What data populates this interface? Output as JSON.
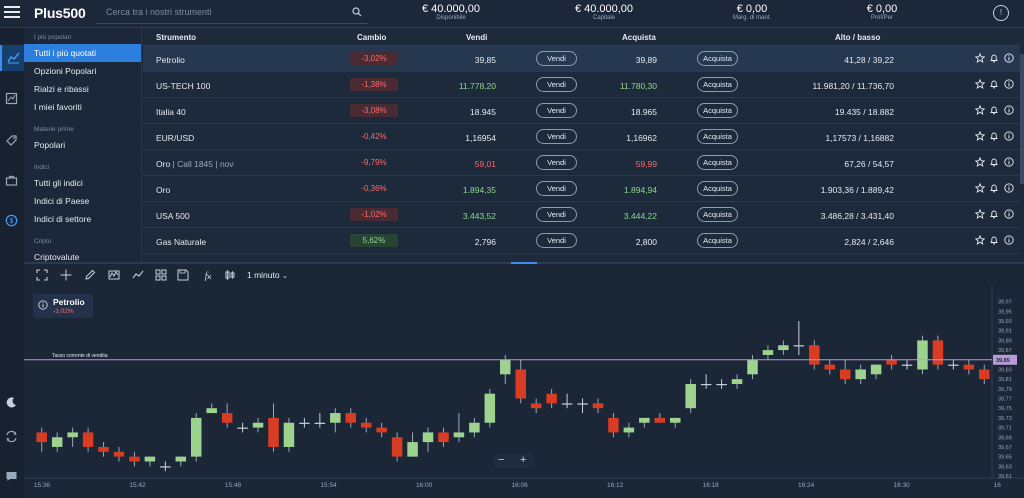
{
  "topbar": {
    "brand": "Plus500",
    "search_placeholder": "Cerca tra i nostri strumenti",
    "stats": [
      {
        "value": "€ 40.000,00",
        "label": "Disponibile"
      },
      {
        "value": "€ 40.000,00",
        "label": "Capitale"
      },
      {
        "value": "€ 0,00",
        "label": "Marg. di mant."
      },
      {
        "value": "€ 0,00",
        "label": "Prof/Per"
      }
    ]
  },
  "sidebar": {
    "sections": [
      {
        "title": "I più popolari",
        "items": [
          "Tutti i più quotati",
          "Opzioni Popolari",
          "Rialzi e ribassi",
          "I miei favoriti"
        ]
      },
      {
        "title": "Materie prime",
        "items": [
          "Popolari"
        ]
      },
      {
        "title": "Indici",
        "items": [
          "Tutti gli indici",
          "Indici di Paese",
          "Indici di settore"
        ]
      },
      {
        "title": "Cripto",
        "items": [
          "Criptovalute"
        ]
      }
    ],
    "active_item": "Tutti i più quotati"
  },
  "table": {
    "headers": {
      "name": "Strumento",
      "change": "Cambio",
      "sell": "Vendi",
      "buy": "Acquista",
      "highlow": "Alto / basso"
    },
    "sell_label": "Vendi",
    "buy_label": "Acquista",
    "rows": [
      {
        "name": "Petrolio",
        "sub": "",
        "change": "-3,02%",
        "trend": "neg",
        "sell": "39,85",
        "buy": "39,89",
        "price_color": "neutral",
        "highlow": "41,28 / 39,22",
        "selected": true
      },
      {
        "name": "US-TECH 100",
        "sub": "",
        "change": "-1,38%",
        "trend": "neg",
        "sell": "11.778,20",
        "buy": "11.780,30",
        "price_color": "up",
        "highlow": "11.981,20 / 11.736,70",
        "selected": false
      },
      {
        "name": "Italia 40",
        "sub": "",
        "change": "-3,08%",
        "trend": "neg",
        "sell": "18.945",
        "buy": "18.965",
        "price_color": "neutral",
        "highlow": "19.435 / 18.882",
        "selected": false
      },
      {
        "name": "EUR/USD",
        "sub": "",
        "change": "-0,42%",
        "trend": "neg-text",
        "sell": "1,16954",
        "buy": "1,16962",
        "price_color": "neutral",
        "highlow": "1,17573 / 1,16882",
        "selected": false
      },
      {
        "name": "Oro",
        "sub": " | Call 1845 | nov",
        "change": "-9,79%",
        "trend": "neg-text",
        "sell": "59,01",
        "buy": "59,99",
        "price_color": "down",
        "highlow": "67,26 / 54,57",
        "selected": false
      },
      {
        "name": "Oro",
        "sub": "",
        "change": "-0,36%",
        "trend": "neg-text",
        "sell": "1.894,35",
        "buy": "1.894,94",
        "price_color": "up",
        "highlow": "1.903,36 / 1.889,42",
        "selected": false
      },
      {
        "name": "USA 500",
        "sub": "",
        "change": "-1,02%",
        "trend": "neg",
        "sell": "3.443,52",
        "buy": "3.444,22",
        "price_color": "up",
        "highlow": "3.486,28 / 3.431,40",
        "selected": false
      },
      {
        "name": "Gas Naturale",
        "sub": "",
        "change": "5,62%",
        "trend": "pos",
        "sell": "2,796",
        "buy": "2,800",
        "price_color": "neutral",
        "highlow": "2,824 / 2,646",
        "selected": false
      }
    ]
  },
  "chart_toolbar": {
    "timeframe": "1 minuto"
  },
  "chart_info": {
    "instrument": "Petrolio",
    "change": "-3,02%"
  },
  "chart_data": {
    "type": "candlestick",
    "instrument": "Petrolio",
    "price_line_label": "Tasso corrente di vendita",
    "current_price_tag": "39,85",
    "current_price": 39.85,
    "ylim": [
      39.61,
      39.99
    ],
    "yticks": [
      "39,61",
      "39,63",
      "39,65",
      "39,67",
      "39,69",
      "39,71",
      "39,73",
      "39,75",
      "39,77",
      "39,79",
      "39,81",
      "39,83",
      "39,85",
      "39,87",
      "39,89",
      "39,91",
      "39,93",
      "39,95",
      "39,97"
    ],
    "xticks": [
      "15:36",
      "15:42",
      "15:48",
      "15:54",
      "16:00",
      "16:06",
      "16:12",
      "16:18",
      "16:24",
      "16:30",
      "16"
    ],
    "candles": [
      {
        "o": 39.7,
        "h": 39.71,
        "l": 39.66,
        "c": 39.68
      },
      {
        "o": 39.67,
        "h": 39.7,
        "l": 39.66,
        "c": 39.69
      },
      {
        "o": 39.69,
        "h": 39.71,
        "l": 39.67,
        "c": 39.7
      },
      {
        "o": 39.7,
        "h": 39.71,
        "l": 39.66,
        "c": 39.67
      },
      {
        "o": 39.67,
        "h": 39.68,
        "l": 39.65,
        "c": 39.66
      },
      {
        "o": 39.66,
        "h": 39.67,
        "l": 39.64,
        "c": 39.65
      },
      {
        "o": 39.65,
        "h": 39.66,
        "l": 39.63,
        "c": 39.64
      },
      {
        "o": 39.64,
        "h": 39.65,
        "l": 39.63,
        "c": 39.65
      },
      {
        "o": 39.63,
        "h": 39.64,
        "l": 39.62,
        "c": 39.63
      },
      {
        "o": 39.64,
        "h": 39.65,
        "l": 39.63,
        "c": 39.65
      },
      {
        "o": 39.65,
        "h": 39.74,
        "l": 39.64,
        "c": 39.73
      },
      {
        "o": 39.74,
        "h": 39.76,
        "l": 39.74,
        "c": 39.75
      },
      {
        "o": 39.74,
        "h": 39.76,
        "l": 39.71,
        "c": 39.72
      },
      {
        "o": 39.71,
        "h": 39.72,
        "l": 39.7,
        "c": 39.71
      },
      {
        "o": 39.71,
        "h": 39.73,
        "l": 39.7,
        "c": 39.72
      },
      {
        "o": 39.73,
        "h": 39.76,
        "l": 39.66,
        "c": 39.67
      },
      {
        "o": 39.67,
        "h": 39.73,
        "l": 39.66,
        "c": 39.72
      },
      {
        "o": 39.72,
        "h": 39.73,
        "l": 39.71,
        "c": 39.72
      },
      {
        "o": 39.72,
        "h": 39.74,
        "l": 39.71,
        "c": 39.72
      },
      {
        "o": 39.72,
        "h": 39.75,
        "l": 39.7,
        "c": 39.74
      },
      {
        "o": 39.74,
        "h": 39.75,
        "l": 39.71,
        "c": 39.72
      },
      {
        "o": 39.72,
        "h": 39.73,
        "l": 39.7,
        "c": 39.71
      },
      {
        "o": 39.71,
        "h": 39.72,
        "l": 39.69,
        "c": 39.7
      },
      {
        "o": 39.69,
        "h": 39.7,
        "l": 39.64,
        "c": 39.65
      },
      {
        "o": 39.65,
        "h": 39.7,
        "l": 39.65,
        "c": 39.68
      },
      {
        "o": 39.68,
        "h": 39.71,
        "l": 39.66,
        "c": 39.7
      },
      {
        "o": 39.7,
        "h": 39.71,
        "l": 39.67,
        "c": 39.68
      },
      {
        "o": 39.69,
        "h": 39.74,
        "l": 39.68,
        "c": 39.7
      },
      {
        "o": 39.7,
        "h": 39.73,
        "l": 39.69,
        "c": 39.72
      },
      {
        "o": 39.72,
        "h": 39.79,
        "l": 39.71,
        "c": 39.78
      },
      {
        "o": 39.82,
        "h": 39.86,
        "l": 39.8,
        "c": 39.85
      },
      {
        "o": 39.83,
        "h": 39.85,
        "l": 39.76,
        "c": 39.77
      },
      {
        "o": 39.76,
        "h": 39.77,
        "l": 39.74,
        "c": 39.75
      },
      {
        "o": 39.78,
        "h": 39.79,
        "l": 39.75,
        "c": 39.76
      },
      {
        "o": 39.76,
        "h": 39.78,
        "l": 39.75,
        "c": 39.76
      },
      {
        "o": 39.76,
        "h": 39.77,
        "l": 39.74,
        "c": 39.76
      },
      {
        "o": 39.76,
        "h": 39.77,
        "l": 39.74,
        "c": 39.75
      },
      {
        "o": 39.73,
        "h": 39.74,
        "l": 39.69,
        "c": 39.7
      },
      {
        "o": 39.7,
        "h": 39.72,
        "l": 39.69,
        "c": 39.71
      },
      {
        "o": 39.72,
        "h": 39.73,
        "l": 39.71,
        "c": 39.73
      },
      {
        "o": 39.73,
        "h": 39.74,
        "l": 39.72,
        "c": 39.72
      },
      {
        "o": 39.72,
        "h": 39.73,
        "l": 39.71,
        "c": 39.73
      },
      {
        "o": 39.75,
        "h": 39.81,
        "l": 39.74,
        "c": 39.8
      },
      {
        "o": 39.8,
        "h": 39.82,
        "l": 39.79,
        "c": 39.8
      },
      {
        "o": 39.8,
        "h": 39.81,
        "l": 39.79,
        "c": 39.8
      },
      {
        "o": 39.8,
        "h": 39.82,
        "l": 39.79,
        "c": 39.81
      },
      {
        "o": 39.82,
        "h": 39.86,
        "l": 39.81,
        "c": 39.85
      },
      {
        "o": 39.86,
        "h": 39.88,
        "l": 39.85,
        "c": 39.87
      },
      {
        "o": 39.87,
        "h": 39.89,
        "l": 39.86,
        "c": 39.88
      },
      {
        "o": 39.88,
        "h": 39.93,
        "l": 39.86,
        "c": 39.88
      },
      {
        "o": 39.88,
        "h": 39.89,
        "l": 39.83,
        "c": 39.84
      },
      {
        "o": 39.84,
        "h": 39.85,
        "l": 39.82,
        "c": 39.83
      },
      {
        "o": 39.83,
        "h": 39.85,
        "l": 39.8,
        "c": 39.81
      },
      {
        "o": 39.81,
        "h": 39.84,
        "l": 39.8,
        "c": 39.83
      },
      {
        "o": 39.82,
        "h": 39.84,
        "l": 39.81,
        "c": 39.84
      },
      {
        "o": 39.85,
        "h": 39.86,
        "l": 39.83,
        "c": 39.84
      },
      {
        "o": 39.84,
        "h": 39.85,
        "l": 39.83,
        "c": 39.84
      },
      {
        "o": 39.83,
        "h": 39.9,
        "l": 39.82,
        "c": 39.89
      },
      {
        "o": 39.89,
        "h": 39.9,
        "l": 39.83,
        "c": 39.84
      },
      {
        "o": 39.84,
        "h": 39.85,
        "l": 39.83,
        "c": 39.84
      },
      {
        "o": 39.84,
        "h": 39.85,
        "l": 39.82,
        "c": 39.83
      },
      {
        "o": 39.83,
        "h": 39.84,
        "l": 39.8,
        "c": 39.81
      }
    ]
  }
}
